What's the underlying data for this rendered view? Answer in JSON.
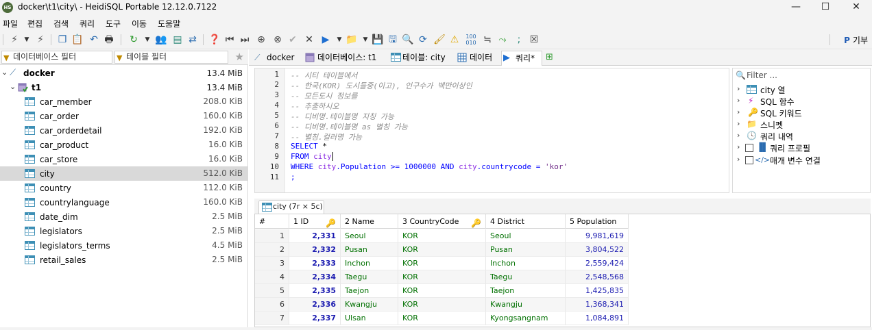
{
  "window": {
    "title": "docker\\t1\\city\\ - HeidiSQL Portable 12.12.0.7122",
    "app_icon_text": "HS"
  },
  "menu": [
    "파일",
    "편집",
    "검색",
    "쿼리",
    "도구",
    "이동",
    "도움말"
  ],
  "toolbar": {
    "donate_label": "기부"
  },
  "left": {
    "db_filter_placeholder": "데이터베이스 필터",
    "table_filter_placeholder": "테이블 필터",
    "tree": {
      "server": {
        "name": "docker",
        "size": "13.4 MiB"
      },
      "database": {
        "name": "t1",
        "size": "13.4 MiB"
      },
      "tables": [
        {
          "name": "car_member",
          "size": "208.0 KiB",
          "fill": 0.1
        },
        {
          "name": "car_order",
          "size": "160.0 KiB",
          "fill": 0.08
        },
        {
          "name": "car_orderdetail",
          "size": "192.0 KiB",
          "fill": 0.09
        },
        {
          "name": "car_product",
          "size": "16.0 KiB",
          "fill": 0.01
        },
        {
          "name": "car_store",
          "size": "16.0 KiB",
          "fill": 0.01
        },
        {
          "name": "city",
          "size": "512.0 KiB",
          "fill": 0.12,
          "selected": true
        },
        {
          "name": "country",
          "size": "112.0 KiB",
          "fill": 0.06
        },
        {
          "name": "countrylanguage",
          "size": "160.0 KiB",
          "fill": 0.08
        },
        {
          "name": "date_dim",
          "size": "2.5 MiB",
          "fill": 0.55
        },
        {
          "name": "legislators",
          "size": "2.5 MiB",
          "fill": 0.55
        },
        {
          "name": "legislators_terms",
          "size": "4.5 MiB",
          "fill": 1.0
        },
        {
          "name": "retail_sales",
          "size": "2.5 MiB",
          "fill": 0.55
        }
      ]
    }
  },
  "tabs": [
    {
      "label": "docker"
    },
    {
      "label": "데이터베이스: t1"
    },
    {
      "label": "테이블: city"
    },
    {
      "label": "데이터"
    },
    {
      "label": "쿼리*"
    }
  ],
  "editor": {
    "line_numbers": [
      "1",
      "2",
      "3",
      "4",
      "5",
      "6",
      "7",
      "8",
      "9",
      "10",
      "11"
    ],
    "lines": {
      "l1": "-- 시티 테이블에서",
      "l2": "-- 한국(KOR) 도시들중(이고), 인구수가 백만이상인",
      "l3": "-- 모든도시 정보를",
      "l4": "-- 추출하시오",
      "l5": "-- 디비명.테이블명 지칭 가능",
      "l6": "-- 디비명.테이블명 as 별칭 가능",
      "l7": "-- 별칭.컬러명 가능",
      "l8_kw": "SELECT",
      "l8_rest": " *",
      "l9_kw": "FROM",
      "l9_id": "city",
      "l10_kw1": "WHERE",
      "l10_id1": "city",
      "l10_col1": ".Population",
      "l10_op": " >= ",
      "l10_num": "1000000",
      "l10_kw2": " AND ",
      "l10_id2": "city",
      "l10_col2": ".countrycode",
      "l10_op2": " = ",
      "l10_str": "'kor'",
      "l11": ";"
    }
  },
  "helper": {
    "filter_placeholder": "Filter ...",
    "items": [
      "city 열",
      "SQL 함수",
      "SQL 키워드",
      "스니펫",
      "쿼리 내역",
      "쿼리 프로필",
      "매개 변수 연결"
    ]
  },
  "result": {
    "tab_label": "city (7r × 5c)",
    "columns": [
      "#",
      "1 ID",
      "2 Name",
      "3 CountryCode",
      "4 District",
      "5 Population"
    ],
    "rows": [
      [
        "1",
        "2,331",
        "Seoul",
        "KOR",
        "Seoul",
        "9,981,619"
      ],
      [
        "2",
        "2,332",
        "Pusan",
        "KOR",
        "Pusan",
        "3,804,522"
      ],
      [
        "3",
        "2,333",
        "Inchon",
        "KOR",
        "Inchon",
        "2,559,424"
      ],
      [
        "4",
        "2,334",
        "Taegu",
        "KOR",
        "Taegu",
        "2,548,568"
      ],
      [
        "5",
        "2,335",
        "Taejon",
        "KOR",
        "Taejon",
        "1,425,835"
      ],
      [
        "6",
        "2,336",
        "Kwangju",
        "KOR",
        "Kwangju",
        "1,368,341"
      ],
      [
        "7",
        "2,337",
        "Ulsan",
        "KOR",
        "Kyongsangnam",
        "1,084,891"
      ]
    ]
  },
  "colors": {
    "accent_blue": "#1a1ab0",
    "text_green": "#007000",
    "keyword_blue": "#0000ff",
    "identifier_purple": "#8a2be2",
    "table_icon": "#3d8fb5"
  }
}
